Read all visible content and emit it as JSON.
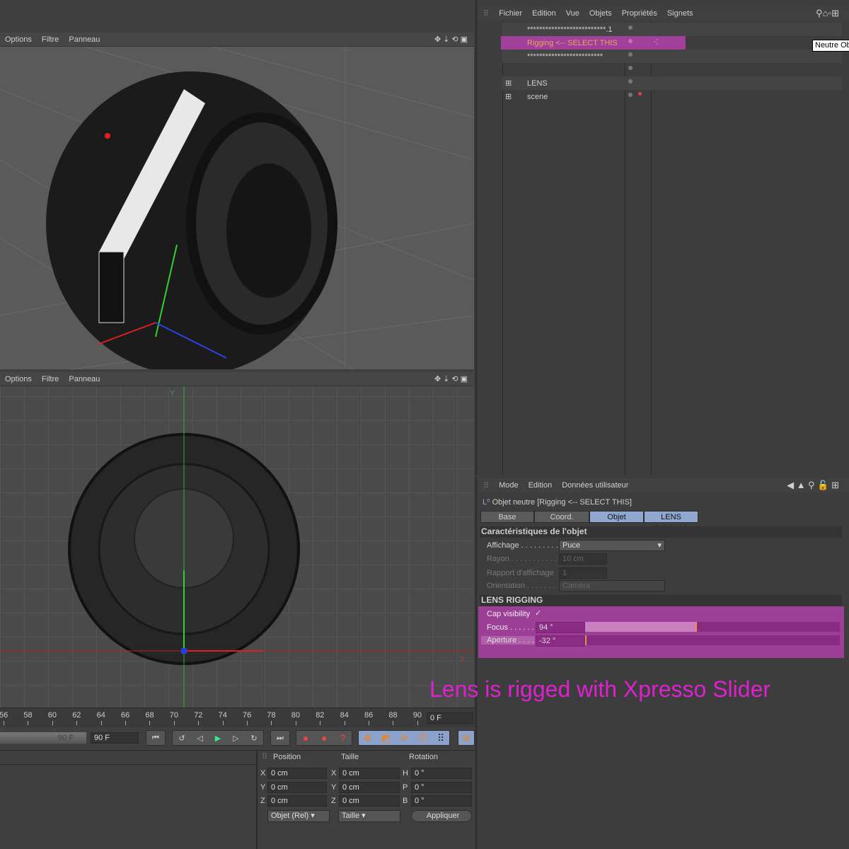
{
  "viewport_top": {
    "menu": [
      "Options",
      "Filtre",
      "Panneau"
    ]
  },
  "viewport_bottom": {
    "menu": [
      "Options",
      "Filtre",
      "Panneau"
    ],
    "axis_y": "Y",
    "axis_x": "X"
  },
  "object_manager": {
    "menu": [
      "Fichier",
      "Edition",
      "Vue",
      "Objets",
      "Propriétés",
      "Signets"
    ],
    "objects": [
      {
        "name": "**************************.1"
      },
      {
        "name": "Rigging <-- SELECT THIS",
        "selected": true
      },
      {
        "name": "*************************"
      },
      {
        "name": ""
      },
      {
        "name": "LENS",
        "expandable": true
      },
      {
        "name": "scene",
        "expandable": true
      }
    ],
    "tooltip": "Neutre Ob"
  },
  "attributes": {
    "menu": [
      "Mode",
      "Edition",
      "Données utilisateur"
    ],
    "title": "Objet neutre [Rigging <-- SELECT THIS]",
    "tabs": [
      {
        "label": "Base"
      },
      {
        "label": "Coord."
      },
      {
        "label": "Objet",
        "active": true
      },
      {
        "label": "LENS RIGGING",
        "active": true
      }
    ],
    "section1": "Caractéristiques de l'objet",
    "affichage_label": "Affichage . . . . . . . . .",
    "affichage_value": "Puce",
    "rayon_label": "Rayon . . . . . . . . . . . .",
    "rayon_value": "10 cm",
    "rapport_label": "Rapport d'affichage",
    "rapport_value": "1",
    "orientation_label": "Orientation . . . . . . .",
    "orientation_value": "Caméra",
    "section2": "LENS RIGGING",
    "cap_label": "Cap visibility",
    "cap_checked": true,
    "cap_mark": "✓",
    "focus_label": "Focus . . . . . .",
    "focus_value": "94 °",
    "focus_fill_percent": 44,
    "aperture_label": "Aperture . . . .",
    "aperture_value": "-32 °",
    "aperture_fill_percent": 0
  },
  "annotation": "Lens is rigged with Xpresso Slider",
  "timeline": {
    "ticks": [
      "56",
      "58",
      "60",
      "62",
      "64",
      "66",
      "68",
      "70",
      "72",
      "74",
      "76",
      "78",
      "80",
      "82",
      "84",
      "86",
      "88",
      "90"
    ],
    "current": "0 F",
    "end_slider": "90 F",
    "end_field": "90 F"
  },
  "coords": {
    "headers": [
      "Position",
      "Taille",
      "Rotation"
    ],
    "rows": [
      {
        "a": "X",
        "pos": "0 cm",
        "b": "X",
        "size": "0 cm",
        "c": "H",
        "rot": "0 °"
      },
      {
        "a": "Y",
        "pos": "0 cm",
        "b": "Y",
        "size": "0 cm",
        "c": "P",
        "rot": "0 °"
      },
      {
        "a": "Z",
        "pos": "0 cm",
        "b": "Z",
        "size": "0 cm",
        "c": "B",
        "rot": "0 °"
      }
    ],
    "mode": "Objet (Rel)",
    "size_mode": "Taille",
    "apply": "Appliquer"
  },
  "colors": {
    "highlight": "#a0409a",
    "accent_text": "#f0a060",
    "annotation": "#e020d0",
    "tab_active": "#90a8d0"
  }
}
